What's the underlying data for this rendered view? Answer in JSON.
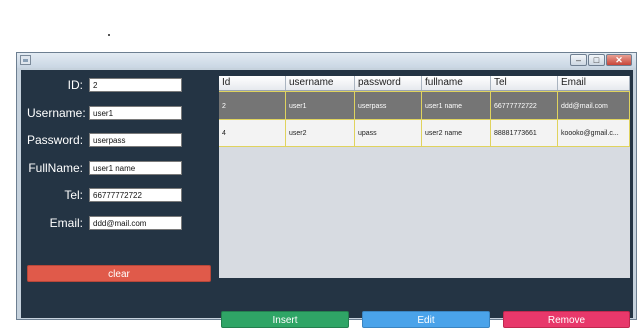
{
  "form": {
    "id_label": "ID:",
    "id_value": "2",
    "username_label": "Username:",
    "username_value": "user1",
    "password_label": "Password:",
    "password_value": "userpass",
    "fullname_label": "FullName:",
    "fullname_value": "user1 name",
    "tel_label": "Tel:",
    "tel_value": "66777772722",
    "email_label": "Email:",
    "email_value": "ddd@mail.com"
  },
  "buttons": {
    "clear": "clear",
    "insert": "Insert",
    "edit": "Edit",
    "remove": "Remove"
  },
  "window": {
    "minimize_glyph": "–",
    "maximize_glyph": "□",
    "close_glyph": "✕"
  },
  "table": {
    "columns": [
      "Id",
      "username",
      "password",
      "fullname",
      "Tel",
      "Email"
    ],
    "rows": [
      [
        "2",
        "user1",
        "userpass",
        "user1 name",
        "66777772722",
        "ddd@mail.com"
      ],
      [
        "4",
        "user2",
        "upass",
        "user2 name",
        "88881773661",
        "koooko@gmail.c..."
      ]
    ],
    "selected_row": 0
  },
  "colors": {
    "panel": "#243444",
    "clear": "#e05a4a",
    "insert": "#2fa566",
    "edit": "#4aa3ea",
    "remove": "#e8386b",
    "selected_row": "#757575"
  }
}
